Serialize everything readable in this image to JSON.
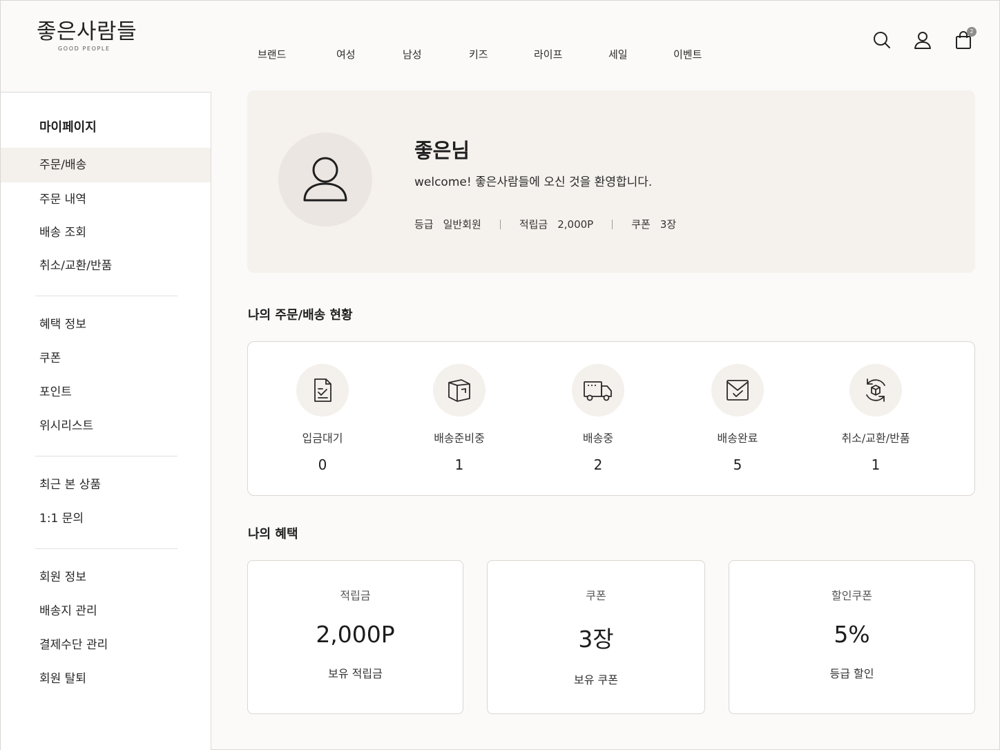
{
  "header": {
    "logo_text": "좋은사람들",
    "logo_sub": "GOOD PEOPLE",
    "nav": [
      "브랜드",
      "여성",
      "남성",
      "키즈",
      "라이프",
      "세일",
      "이벤트"
    ],
    "cart_count": "2",
    "icons": [
      "search-icon",
      "user-icon",
      "shopping-bag-icon"
    ]
  },
  "sidebar": {
    "title": "마이페이지",
    "groups": [
      [
        "주문/배송",
        "주문 내역",
        "배송 조회",
        "취소/교환/반품"
      ],
      [
        "혜택 정보",
        "쿠폰",
        "포인트",
        "위시리스트"
      ],
      [
        "최근 본 상품",
        "1:1 문의"
      ],
      [
        "회원 정보",
        "배송지 관리",
        "결제수단 관리",
        "회원 탈퇴"
      ]
    ],
    "active": "주문/배송"
  },
  "profile": {
    "name": "좋은님",
    "welcome": "welcome! 좋은사람들에 오신 것을 환영합니다.",
    "grade_label": "등급",
    "grade_value": "일반회원",
    "points_label": "적립금",
    "points_value": "2,000P",
    "coupon_label": "쿠폰",
    "coupon_value": "3장"
  },
  "order_status": {
    "title": "나의 주문/배송 현황",
    "items": [
      {
        "label": "입금대기",
        "count": "0",
        "icon": "document-check-icon"
      },
      {
        "label": "배송준비중",
        "count": "1",
        "icon": "package-box-icon"
      },
      {
        "label": "배송중",
        "count": "2",
        "icon": "delivery-truck-icon"
      },
      {
        "label": "배송완료",
        "count": "5",
        "icon": "box-check-icon"
      },
      {
        "label": "취소/교환/반품",
        "count": "1",
        "icon": "return-cycle-icon"
      }
    ]
  },
  "benefits": {
    "title": "나의 혜택",
    "cards": [
      {
        "label": "적립금",
        "value": "2,000P",
        "sub": "보유 적립금"
      },
      {
        "label": "쿠폰",
        "value": "3장",
        "sub": "보유 쿠폰"
      },
      {
        "label": "할인쿠폰",
        "value": "5%",
        "sub": "등급 할인"
      }
    ]
  }
}
